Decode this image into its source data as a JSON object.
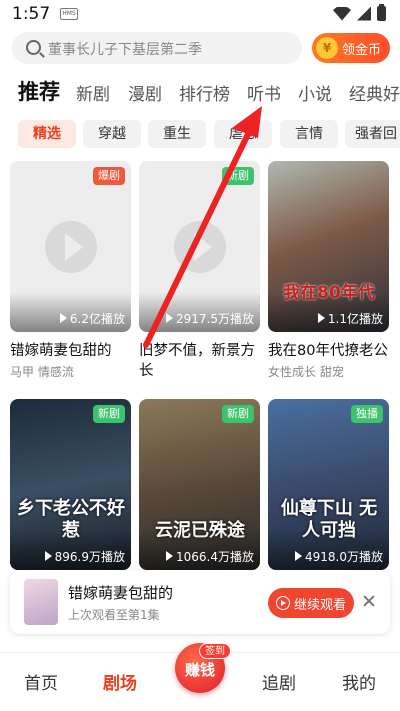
{
  "status_bar": {
    "time": "1:57",
    "hms_label": "HMS"
  },
  "search": {
    "placeholder": "董事长儿子下基层第二季",
    "coin_button": "领金币",
    "coin_symbol": "¥"
  },
  "tabs": [
    "推荐",
    "新剧",
    "漫剧",
    "排行榜",
    "听书",
    "小说",
    "经典好"
  ],
  "active_tab": "推荐",
  "chips": [
    "精选",
    "穿越",
    "重生",
    "虐恋",
    "言情",
    "强者回"
  ],
  "active_chip": "精选",
  "cards": [
    {
      "title": "错嫁萌妻包甜的",
      "tags": "马甲 情感流",
      "plays": "6.2亿播放",
      "badge": "爆剧",
      "badge_color": "#f0573b"
    },
    {
      "title": "旧梦不值，新景方长",
      "tags": "",
      "plays": "2917.5万播放",
      "badge": "新剧",
      "badge_color": "#3cc36b"
    },
    {
      "title": "我在80年代撩老公",
      "tags": "女性成长 甜宠",
      "plays": "1.1亿播放",
      "badge": "",
      "poster_text": "我在80年代"
    },
    {
      "title": "",
      "tags": "",
      "plays": "896.9万播放",
      "badge": "新剧",
      "poster_text": "乡下老公不好惹"
    },
    {
      "title": "",
      "tags": "",
      "plays": "1066.4万播放",
      "badge": "新剧",
      "poster_text": "云泥已殊途"
    },
    {
      "title": "",
      "tags": "",
      "plays": "4918.0万播放",
      "badge": "独播",
      "poster_text": "仙尊下山 无人可挡"
    }
  ],
  "continue_watching": {
    "title": "错嫁萌妻包甜的",
    "subtitle": "上次观看至第1集",
    "button": "继续观看"
  },
  "bottom_nav": {
    "items": [
      "首页",
      "剧场",
      "赚钱",
      "追剧",
      "我的"
    ],
    "active": "剧场",
    "checkin_badge": "签到"
  },
  "colors": {
    "accent": "#e8411e",
    "annotation_arrow": "#ee2222"
  }
}
